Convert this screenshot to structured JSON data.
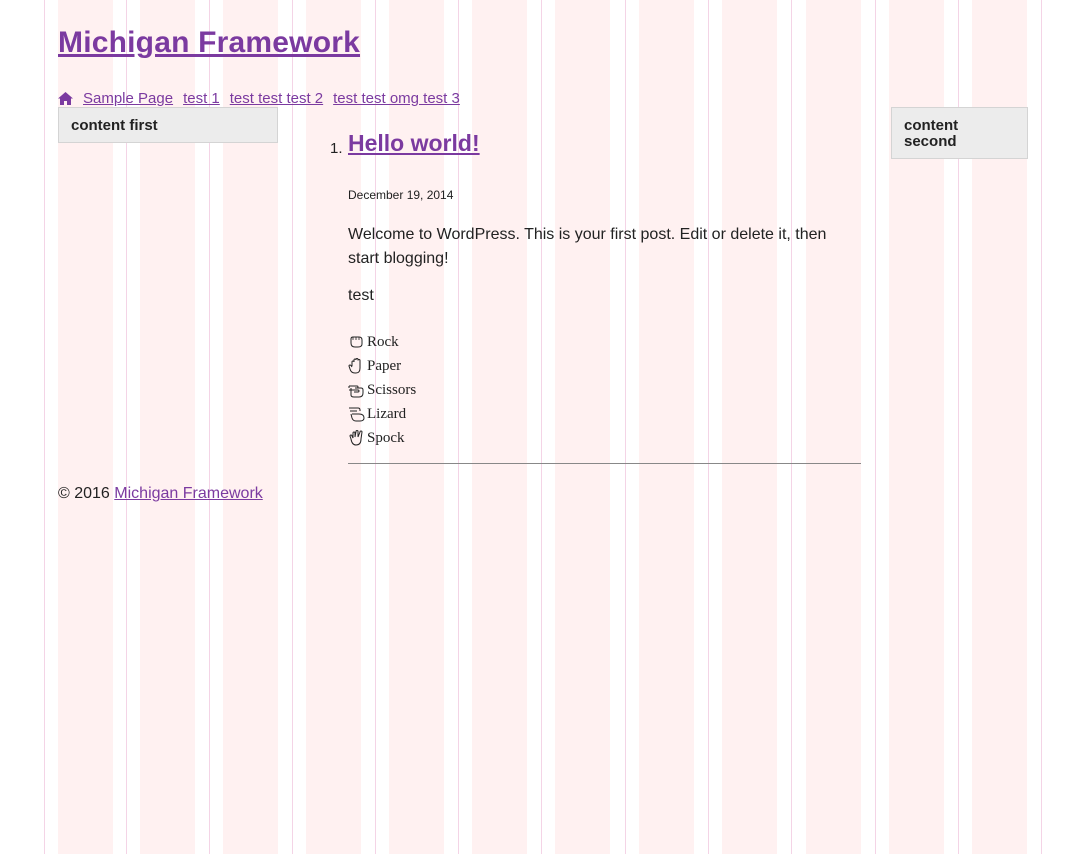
{
  "site": {
    "title": "Michigan Framework"
  },
  "nav": {
    "items": [
      {
        "label": "Sample Page",
        "icon": "home-icon"
      },
      {
        "label": "test 1"
      },
      {
        "label": "test test test 2"
      },
      {
        "label": "test test omg test 3"
      }
    ]
  },
  "sidebar_first": {
    "label": "content first"
  },
  "sidebar_second": {
    "line1": "content",
    "line2": "second"
  },
  "post": {
    "number": "1.",
    "title": "Hello world!",
    "date": "December 19, 2014",
    "body": "Welcome to WordPress. This is your first post. Edit or delete it, then start blogging!",
    "extra": "test",
    "rps": [
      {
        "label": "Rock",
        "icon": "rock-hand-icon"
      },
      {
        "label": "Paper",
        "icon": "paper-hand-icon"
      },
      {
        "label": "Scissors",
        "icon": "scissors-hand-icon"
      },
      {
        "label": "Lizard",
        "icon": "lizard-hand-icon"
      },
      {
        "label": "Spock",
        "icon": "spock-hand-icon"
      }
    ]
  },
  "footer": {
    "copyright": "© 2016 ",
    "link": "Michigan Framework"
  },
  "colors": {
    "link": "#7b3aa0",
    "grid_column": "#fdeeee",
    "box_bg": "#ececec"
  }
}
